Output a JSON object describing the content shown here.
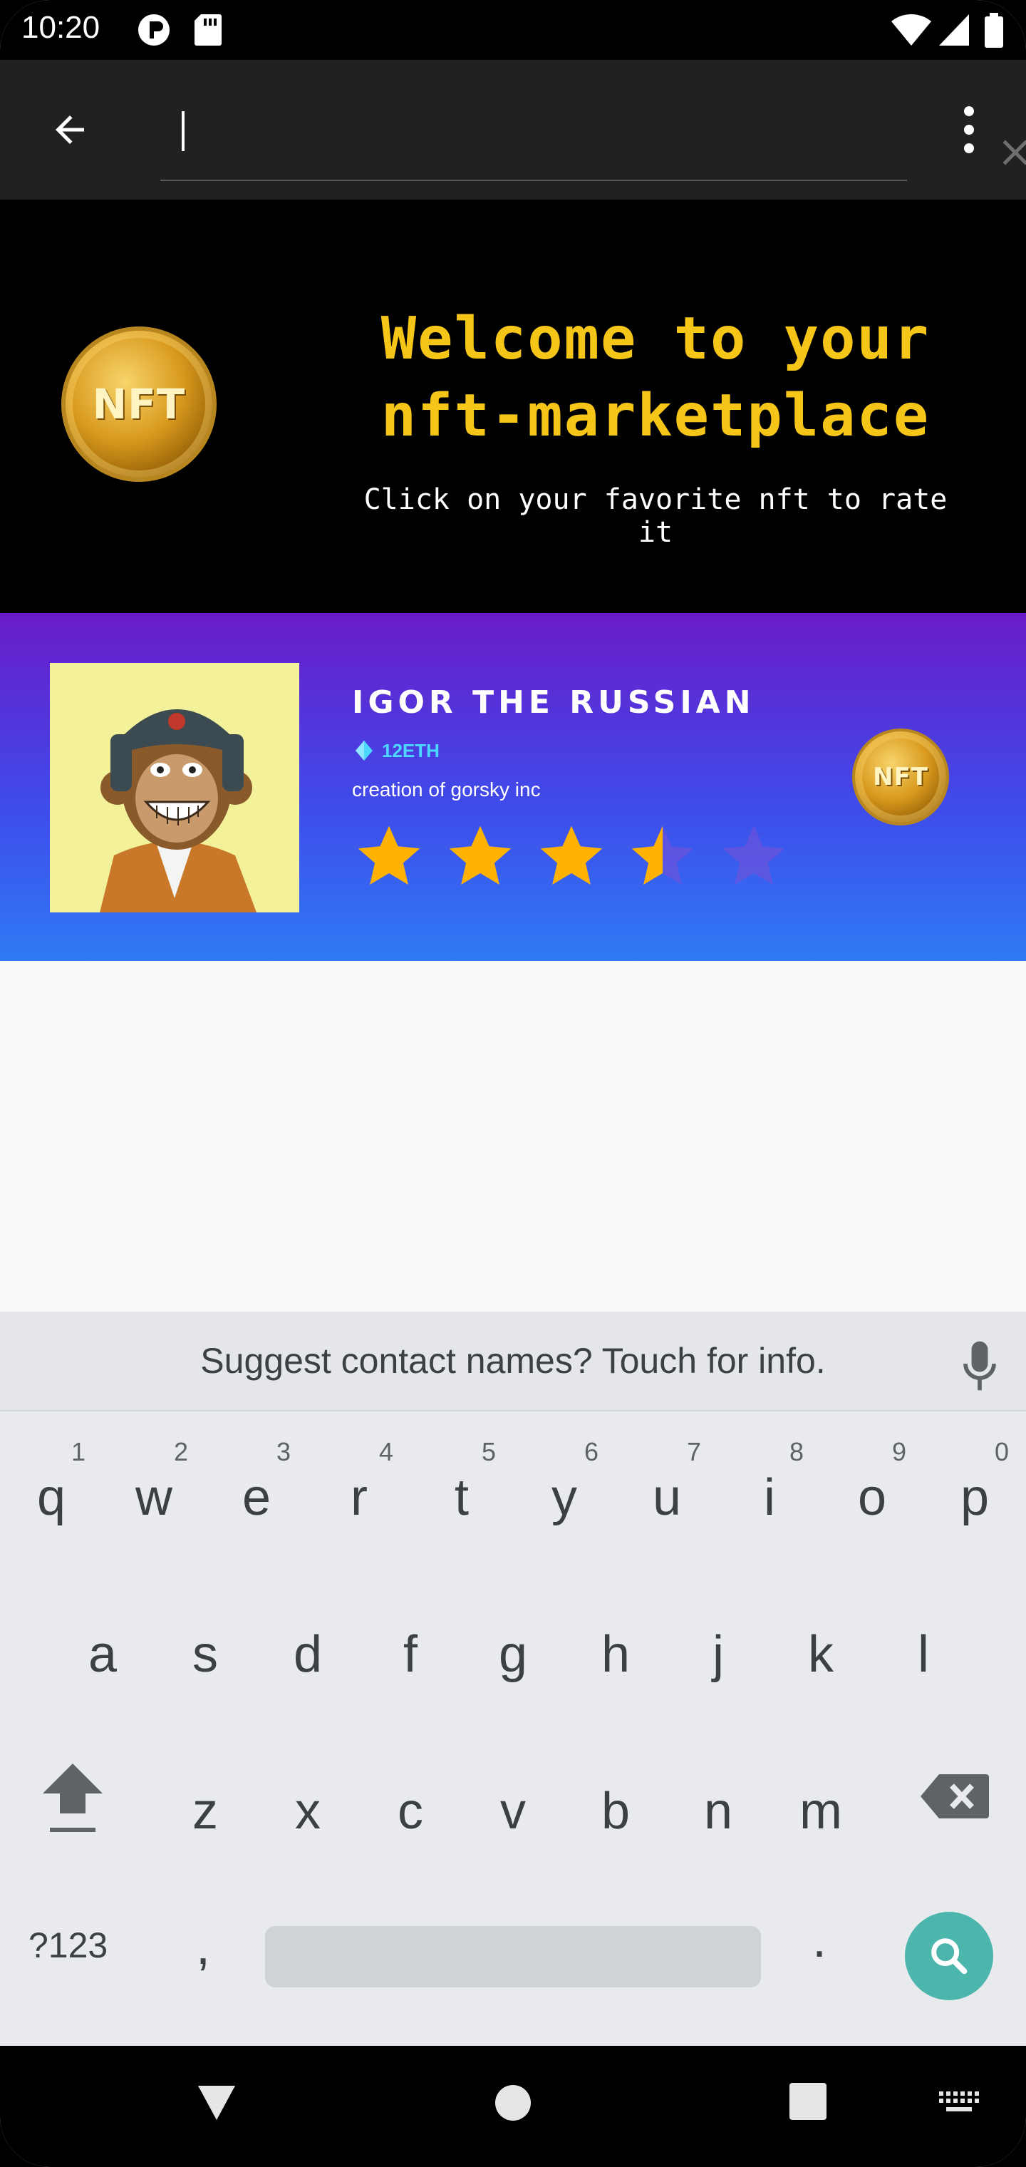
{
  "status_bar": {
    "time": "10:20",
    "icons": [
      "shield-p-icon",
      "sd-card-icon",
      "wifi-icon",
      "signal-icon",
      "battery-icon"
    ]
  },
  "app_bar": {
    "search_value": "",
    "search_placeholder": "",
    "icons": [
      "arrow-back-icon",
      "close-icon",
      "more-vert-icon"
    ]
  },
  "hero": {
    "logo_text": "NFT",
    "title_line1": "Welcome to your",
    "title_line2": "nft-marketplace",
    "subtitle": "Click on your favorite nft to rate it",
    "title_color": "#f5c518"
  },
  "nft_item": {
    "name": "IGOR THE RUSSIAN",
    "price": "12ETH",
    "creator": "creation of gorsky inc",
    "rating": 3.5,
    "rating_max": 5,
    "coin_text": "NFT",
    "star_color": "#ffb300"
  },
  "keyboard": {
    "suggestion": "Suggest contact names? Touch for info.",
    "row1": [
      {
        "key": "q",
        "hint": "1"
      },
      {
        "key": "w",
        "hint": "2"
      },
      {
        "key": "e",
        "hint": "3"
      },
      {
        "key": "r",
        "hint": "4"
      },
      {
        "key": "t",
        "hint": "5"
      },
      {
        "key": "y",
        "hint": "6"
      },
      {
        "key": "u",
        "hint": "7"
      },
      {
        "key": "i",
        "hint": "8"
      },
      {
        "key": "o",
        "hint": "9"
      },
      {
        "key": "p",
        "hint": "0"
      }
    ],
    "row2": [
      "a",
      "s",
      "d",
      "f",
      "g",
      "h",
      "j",
      "k",
      "l"
    ],
    "row3": [
      "z",
      "x",
      "c",
      "v",
      "b",
      "n",
      "m"
    ],
    "symbols_label": "?123",
    "comma": ",",
    "period": ".",
    "accent_color": "#4db6ac"
  },
  "nav_bar": {
    "icons": [
      "back-triangle-icon",
      "home-circle-icon",
      "recents-square-icon",
      "keyboard-icon"
    ]
  }
}
